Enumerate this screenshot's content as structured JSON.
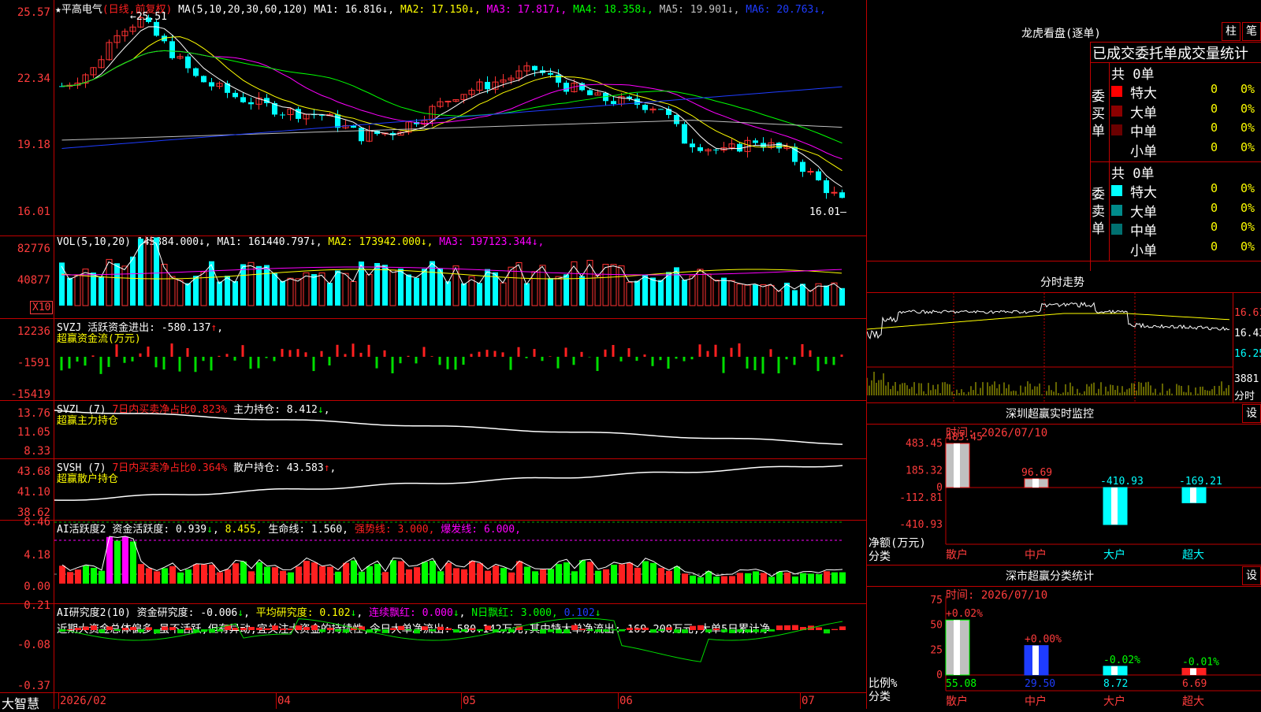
{
  "stock": {
    "name": "平高电气",
    "period": "(日线,前复权)",
    "ma_title": "MA(5,10,20,30,60,120)",
    "ma": [
      {
        "label": "MA1:",
        "value": "16.816",
        "color": "#ffffff"
      },
      {
        "label": "MA2:",
        "value": "17.150",
        "color": "#ffff00"
      },
      {
        "label": "MA3:",
        "value": "17.817",
        "color": "#ff00ff"
      },
      {
        "label": "MA4:",
        "value": "18.358",
        "color": "#00ff00"
      },
      {
        "label": "MA5:",
        "value": "19.901",
        "color": "#c0c0c0"
      },
      {
        "label": "MA6:",
        "value": "20.763",
        "color": "#1e3cff"
      }
    ],
    "y_labels": [
      "25.57",
      "22.34",
      "19.18",
      "16.01"
    ],
    "high_marker": "25.51",
    "low_marker": "16.01"
  },
  "vol": {
    "title": "VOL(5,10,20)",
    "value": "145884.000",
    "ma": [
      {
        "label": "MA1:",
        "value": "161440.797",
        "color": "#ffffff"
      },
      {
        "label": "MA2:",
        "value": "173942.000",
        "color": "#ffff00"
      },
      {
        "label": "MA3:",
        "value": "197123.344",
        "color": "#ff00ff"
      }
    ],
    "y_labels": [
      "82776",
      "40877"
    ],
    "unit": "X10"
  },
  "svzj": {
    "title": "SVZJ",
    "label": "活跃资金进出:",
    "value": "-580.137",
    "subtitle": "超赢资金流(万元)",
    "y_labels": [
      "12236",
      "-1591",
      "-15419"
    ]
  },
  "svzl": {
    "title": "SVZL (7)",
    "desc": "7日内买卖净占比0.823%",
    "label": "主力持仓:",
    "value": "8.412",
    "subtitle": "超赢主力持仓",
    "y_labels": [
      "13.76",
      "11.05",
      "8.33"
    ]
  },
  "svsh": {
    "title": "SVSH (7)",
    "desc": "7日内买卖净占比0.364%",
    "label": "散户持仓:",
    "value": "43.583",
    "subtitle": "超赢散户持仓",
    "y_labels": [
      "43.68",
      "41.10",
      "38.62"
    ]
  },
  "ai_active": {
    "title": "AI活跃度2",
    "label1": "资金活跃度:",
    "value1": "0.939",
    "value2": "8.455,",
    "label3": "生命线:",
    "value3": "1.560,",
    "strong": "强势线: 3.000,",
    "burst": "爆发线: 6.000,",
    "y_labels": [
      "8.46",
      "4.18",
      "0.00"
    ]
  },
  "ai_research": {
    "title": "AI研究度2(10)",
    "label1": "资金研究度:",
    "value1": "-0.006",
    "avg": "平均研究度: 0.102",
    "cont": "连续飘红: 0.000",
    "nday": "N日飘红: 3.000,",
    "tail": "0.102",
    "comment": "近期大资金总体偏多,虽不活跃,但有异动,宜关注大资金的持续性,今日大单净流出:-580.142万元,其中特大单净流出:-169.208万元,大单5日累计净",
    "y_labels": [
      "0.21",
      "-0.08",
      "-0.37"
    ]
  },
  "xaxis": {
    "brand": "大智慧",
    "labels": [
      "2026/02",
      "04",
      "05",
      "06",
      "07"
    ]
  },
  "dragon": {
    "title": "龙虎看盘(逐单)",
    "tab1": "柱",
    "tab2": "笔",
    "header": "已成交委托单成交量统计",
    "buy_label": "委买单",
    "sell_label": "委卖单",
    "buy_total": "共 0单",
    "sell_total": "共 0单",
    "buy_rows": [
      {
        "name": "特大",
        "count": "0",
        "pct": "0%",
        "color": "#ff0000"
      },
      {
        "name": "大单",
        "count": "0",
        "pct": "0%",
        "color": "#8b0000"
      },
      {
        "name": "中单",
        "count": "0",
        "pct": "0%",
        "color": "#6b0000"
      },
      {
        "name": "小单",
        "count": "0",
        "pct": "0%",
        "color": ""
      }
    ],
    "sell_rows": [
      {
        "name": "特大",
        "count": "0",
        "pct": "0%",
        "color": "#00ffff"
      },
      {
        "name": "大单",
        "count": "0",
        "pct": "0%",
        "color": "#008b8b"
      },
      {
        "name": "中单",
        "count": "0",
        "pct": "0%",
        "color": "#007070"
      },
      {
        "name": "小单",
        "count": "0",
        "pct": "0%",
        "color": ""
      }
    ]
  },
  "intraday": {
    "title": "分时走势",
    "prices": [
      "16.61",
      "16.43",
      "16.25"
    ],
    "volume_label": "3881",
    "volume_unit": "分时"
  },
  "monitor": {
    "title": "深圳超赢实时监控",
    "set": "设",
    "time": "时间: 2026/07/10",
    "ylabel": "净额(万元)",
    "xlabel": "分类",
    "y_labels": [
      "483.45",
      "185.32",
      "0",
      "-112.81",
      "-410.93"
    ],
    "bars": [
      {
        "name": "散户",
        "value": 483.45,
        "label": "483.45"
      },
      {
        "name": "中户",
        "value": 96.69,
        "label": "96.69"
      },
      {
        "name": "大户",
        "value": -410.93,
        "label": "-410.93"
      },
      {
        "name": "超大",
        "value": -169.21,
        "label": "-169.21"
      }
    ]
  },
  "classify": {
    "title": "深市超赢分类统计",
    "set": "设",
    "time": "时间: 2026/07/10",
    "ylabel": "比例%",
    "xlabel": "分类",
    "y_labels": [
      "75",
      "50",
      "25",
      "0"
    ],
    "bars": [
      {
        "name": "散户",
        "value": 55.08,
        "change": "+0.02%",
        "label": "55.08"
      },
      {
        "name": "中户",
        "value": 29.5,
        "change": "+0.00%",
        "label": "29.50"
      },
      {
        "name": "大户",
        "value": 8.72,
        "change": "-0.02%",
        "label": "8.72"
      },
      {
        "name": "超大",
        "value": 6.69,
        "change": "-0.01%",
        "label": "6.69"
      }
    ]
  }
}
